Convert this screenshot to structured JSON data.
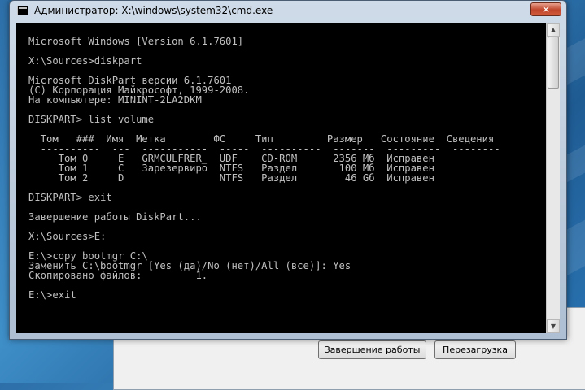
{
  "window": {
    "title": "Администратор: X:\\windows\\system32\\cmd.exe",
    "close_label": "✕"
  },
  "console": {
    "text": "Microsoft Windows [Version 6.1.7601]\n\nX:\\Sources>diskpart\n\nMicrosoft DiskPart версии 6.1.7601\n(С) Корпорация Майкрософт, 1999-2008.\nНа компьютере: MININT-2LA2DKM\n\nDISKPART> list volume\n\n  Том   ###  Имя  Метка        ФС     Тип         Размер   Состояние  Сведения\n  ----------  ---  -----------  -----  ----------  -------  ---------  --------\n     Том 0     E   GRMCULFRER_  UDF    CD-ROM      2356 Мб  Исправен\n     Том 1     C   Зарезервиро  NTFS   Раздел       100 Мб  Исправен\n     Том 2     D                NTFS   Раздел        46 Gб  Исправен\n\nDISKPART> exit\n\nЗавершение работы DiskPart...\n\nX:\\Sources>E:\n\nE:\\>copy bootmgr C:\\\nЗаменить C:\\bootmgr [Yes (да)/No (нет)/All (все)]: Yes\nСкопировано файлов:         1.\n\nE:\\>exit"
  },
  "scrollbar": {
    "up_icon": "▲",
    "down_icon": "▼"
  },
  "shutdown_dialog": {
    "shutdown_label": "Завершение работы",
    "restart_label": "Перезагрузка"
  }
}
